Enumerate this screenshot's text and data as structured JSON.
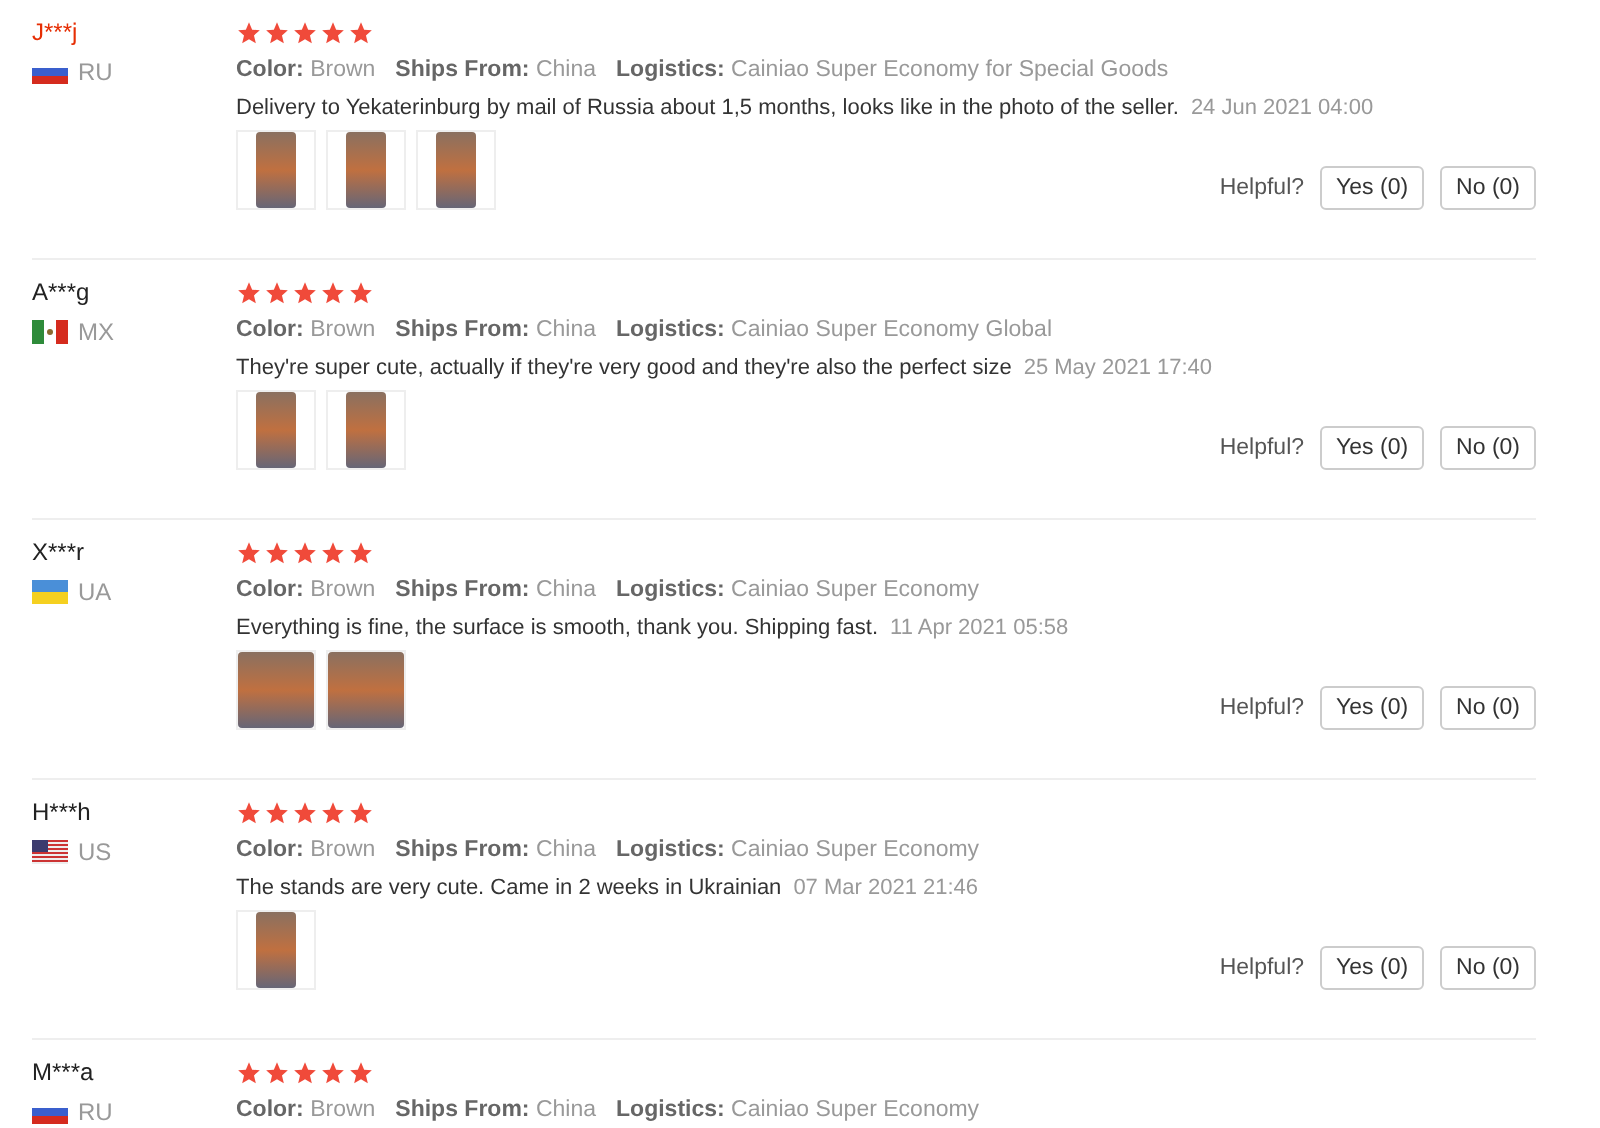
{
  "reviews": [
    {
      "name": "J***j",
      "highlighted": true,
      "kind": "ru",
      "country": "RU",
      "stars": 5,
      "meta": [
        {
          "label": "Color:",
          "value": "Brown"
        },
        {
          "label": "Ships From:",
          "value": "China"
        },
        {
          "label": "Logistics:",
          "value": "Cainiao Super Economy for Special Goods"
        }
      ],
      "text": "Delivery to Yekaterinburg by mail of Russia about 1,5 months, looks like in the photo of the seller.",
      "date": "24 Jun 2021 04:00",
      "photos": [
        {
          "kind": "tall"
        },
        {
          "kind": "tall"
        },
        {
          "kind": "tall"
        }
      ],
      "helpful": {
        "label": "Helpful?",
        "yes": "Yes (0)",
        "no": "No (0)"
      }
    },
    {
      "name": "A***g",
      "highlighted": false,
      "kind": "mx",
      "country": "MX",
      "stars": 5,
      "meta": [
        {
          "label": "Color:",
          "value": "Brown"
        },
        {
          "label": "Ships From:",
          "value": "China"
        },
        {
          "label": "Logistics:",
          "value": "Cainiao Super Economy Global"
        }
      ],
      "text": "They're super cute, actually if they're very good and they're also the perfect size",
      "date": "25 May 2021 17:40",
      "photos": [
        {
          "kind": "tall"
        },
        {
          "kind": "tall"
        }
      ],
      "helpful": {
        "label": "Helpful?",
        "yes": "Yes (0)",
        "no": "No (0)"
      }
    },
    {
      "name": "X***r",
      "highlighted": false,
      "kind": "ua",
      "country": "UA",
      "stars": 5,
      "meta": [
        {
          "label": "Color:",
          "value": "Brown"
        },
        {
          "label": "Ships From:",
          "value": "China"
        },
        {
          "label": "Logistics:",
          "value": "Cainiao Super Economy"
        }
      ],
      "text": "Everything is fine, the surface is smooth, thank you. Shipping fast.",
      "date": "11 Apr 2021 05:58",
      "photos": [
        {
          "kind": "full"
        },
        {
          "kind": "full"
        }
      ],
      "helpful": {
        "label": "Helpful?",
        "yes": "Yes (0)",
        "no": "No (0)"
      }
    },
    {
      "name": "H***h",
      "highlighted": false,
      "kind": "us",
      "country": "US",
      "stars": 5,
      "meta": [
        {
          "label": "Color:",
          "value": "Brown"
        },
        {
          "label": "Ships From:",
          "value": "China"
        },
        {
          "label": "Logistics:",
          "value": "Cainiao Super Economy"
        }
      ],
      "text": "The stands are very cute. Came in 2 weeks in Ukrainian",
      "date": "07 Mar 2021 21:46",
      "photos": [
        {
          "kind": "tall"
        }
      ],
      "helpful": {
        "label": "Helpful?",
        "yes": "Yes (0)",
        "no": "No (0)"
      }
    },
    {
      "name": "M***a",
      "highlighted": false,
      "kind": "ru",
      "country": "RU",
      "stars": 5,
      "meta": [
        {
          "label": "Color:",
          "value": "Brown"
        },
        {
          "label": "Ships From:",
          "value": "China"
        },
        {
          "label": "Logistics:",
          "value": "Cainiao Super Economy"
        }
      ]
    }
  ]
}
